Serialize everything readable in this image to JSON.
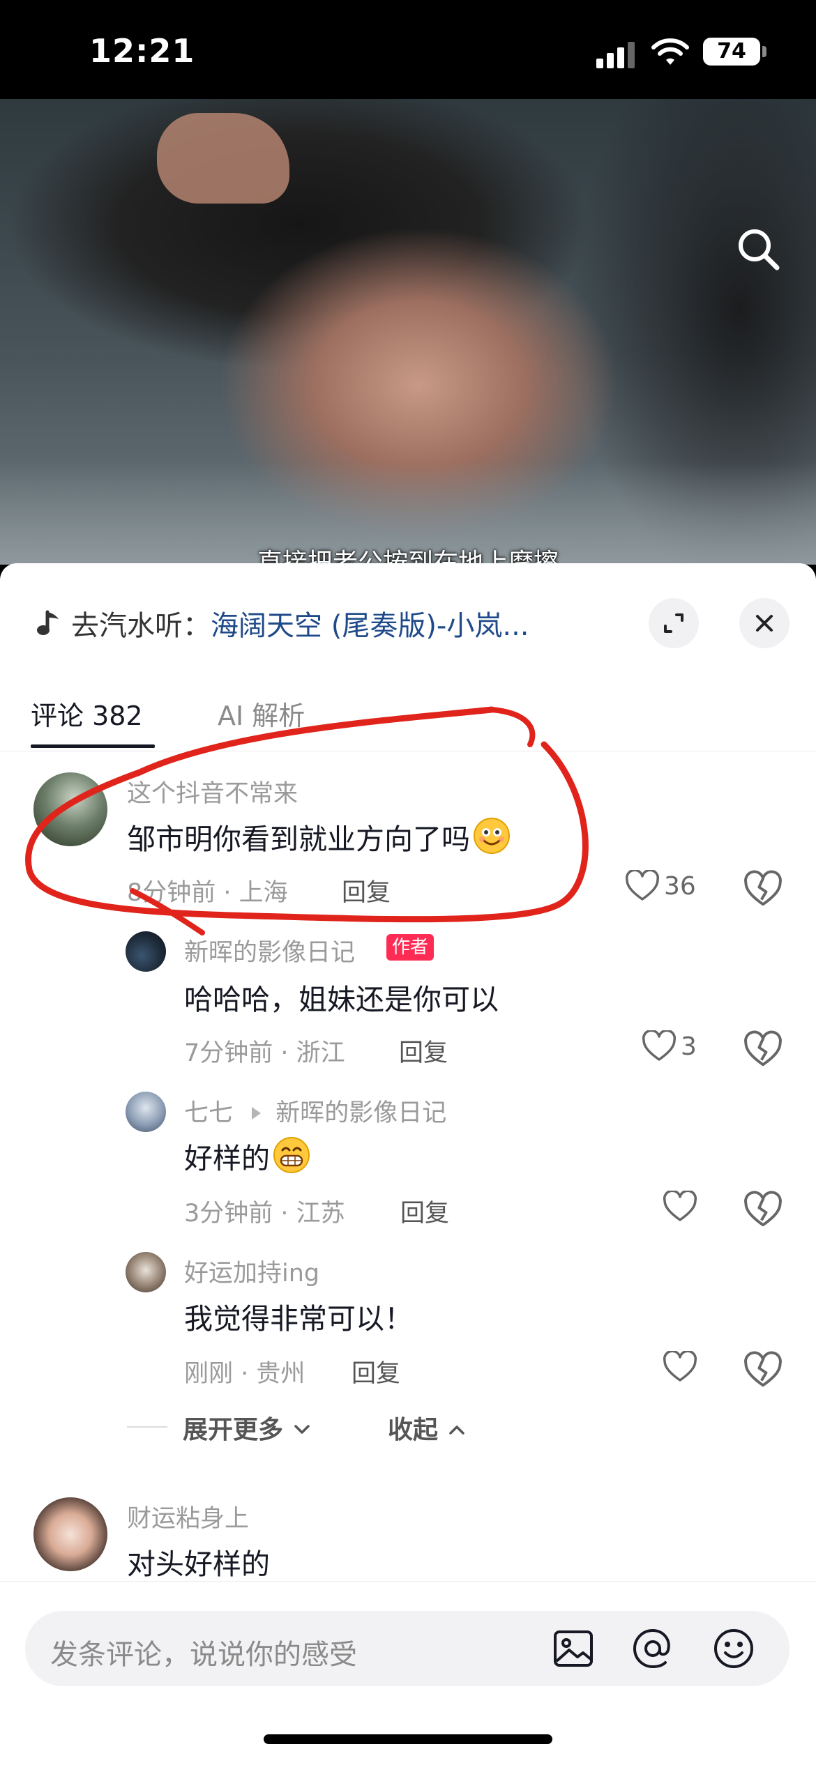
{
  "status_bar": {
    "time": "12:21",
    "battery": "74"
  },
  "video": {
    "subtitle": "直接把老公按到在地上摩擦"
  },
  "music": {
    "prefix": "去汽水听：",
    "title": "海阔天空 (尾奏版)-小岚..."
  },
  "tabs": [
    {
      "label": "评论 382",
      "active": true
    },
    {
      "label": "AI 解析",
      "active": false
    }
  ],
  "comments": [
    {
      "user": "这个抖音不常来",
      "text": "邹市明你看到就业方向了吗",
      "emoji": "smiley-emoji",
      "time": "8分钟前 · 上海",
      "reply": "回复",
      "likes": "36"
    },
    {
      "user": "新晖的影像日记",
      "badge": "作者",
      "text": "哈哈哈，姐妹还是你可以",
      "time": "7分钟前 · 浙江",
      "reply": "回复",
      "likes": "3"
    },
    {
      "user": "七七",
      "reply_to": "新晖的影像日记",
      "text": "好样的",
      "emoji": "grin-emoji",
      "time": "3分钟前 · 江苏",
      "reply": "回复",
      "likes": ""
    },
    {
      "user": "好运加持ing",
      "text": "我觉得非常可以！",
      "time": "刚刚 · 贵州",
      "reply": "回复",
      "likes": ""
    },
    {
      "user": "财运粘身上",
      "text": "对头好样的"
    }
  ],
  "expand": {
    "more": "展开更多",
    "collapse": "收起"
  },
  "input": {
    "placeholder": "发条评论，说说你的感受"
  },
  "colors": {
    "accent_red": "#fe2c55",
    "annotation_red": "#e0241b",
    "music_blue": "#1f4a8a"
  }
}
